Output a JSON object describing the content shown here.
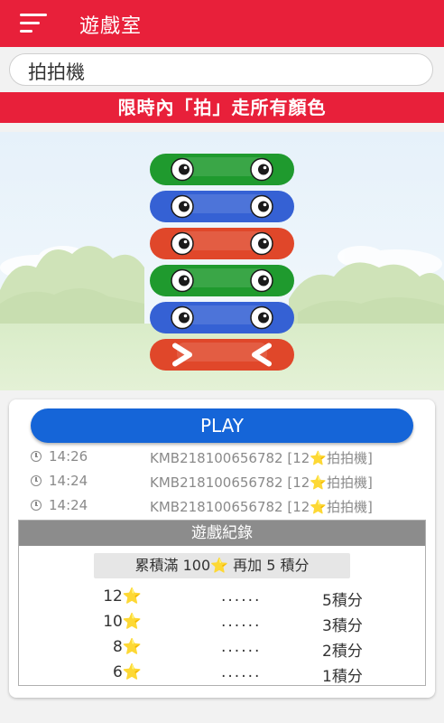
{
  "appbar": {
    "title": "遊戲室",
    "menu_icon": "hamburger-menu-icon"
  },
  "search": {
    "value": "拍拍機"
  },
  "banner": {
    "text": "限時內「拍」走所有顏色"
  },
  "game": {
    "boards": [
      {
        "color": "#1f9a2e",
        "eyes": "eyes"
      },
      {
        "color": "#3561d4",
        "eyes": "eyes"
      },
      {
        "color": "#e0472a",
        "eyes": "eyes"
      },
      {
        "color": "#1f9a2e",
        "eyes": "eyes"
      },
      {
        "color": "#3561d4",
        "eyes": "eyes"
      },
      {
        "color": "#e0472a",
        "eyes": "chevrons"
      }
    ]
  },
  "play": {
    "label": "PLAY"
  },
  "recent": [
    {
      "time": "14:26",
      "desc": "KMB218100656782 [12⭐拍拍機]"
    },
    {
      "time": "14:24",
      "desc": "KMB218100656782 [12⭐拍拍機]"
    },
    {
      "time": "14:24",
      "desc": "KMB218100656782 [12⭐拍拍機]"
    }
  ],
  "records": {
    "header": "遊戲紀錄",
    "rule": "累積滿 100⭐ 再加 5 積分",
    "rows": [
      {
        "stars": "12⭐",
        "dots": "......",
        "points": "5積分"
      },
      {
        "stars": "10⭐",
        "dots": "......",
        "points": "3積分"
      },
      {
        "stars": "8⭐",
        "dots": "......",
        "points": "2積分"
      },
      {
        "stars": "6⭐",
        "dots": "......",
        "points": "1積分"
      }
    ]
  },
  "colors": {
    "accent": "#e8203a",
    "play": "#1565d8"
  }
}
